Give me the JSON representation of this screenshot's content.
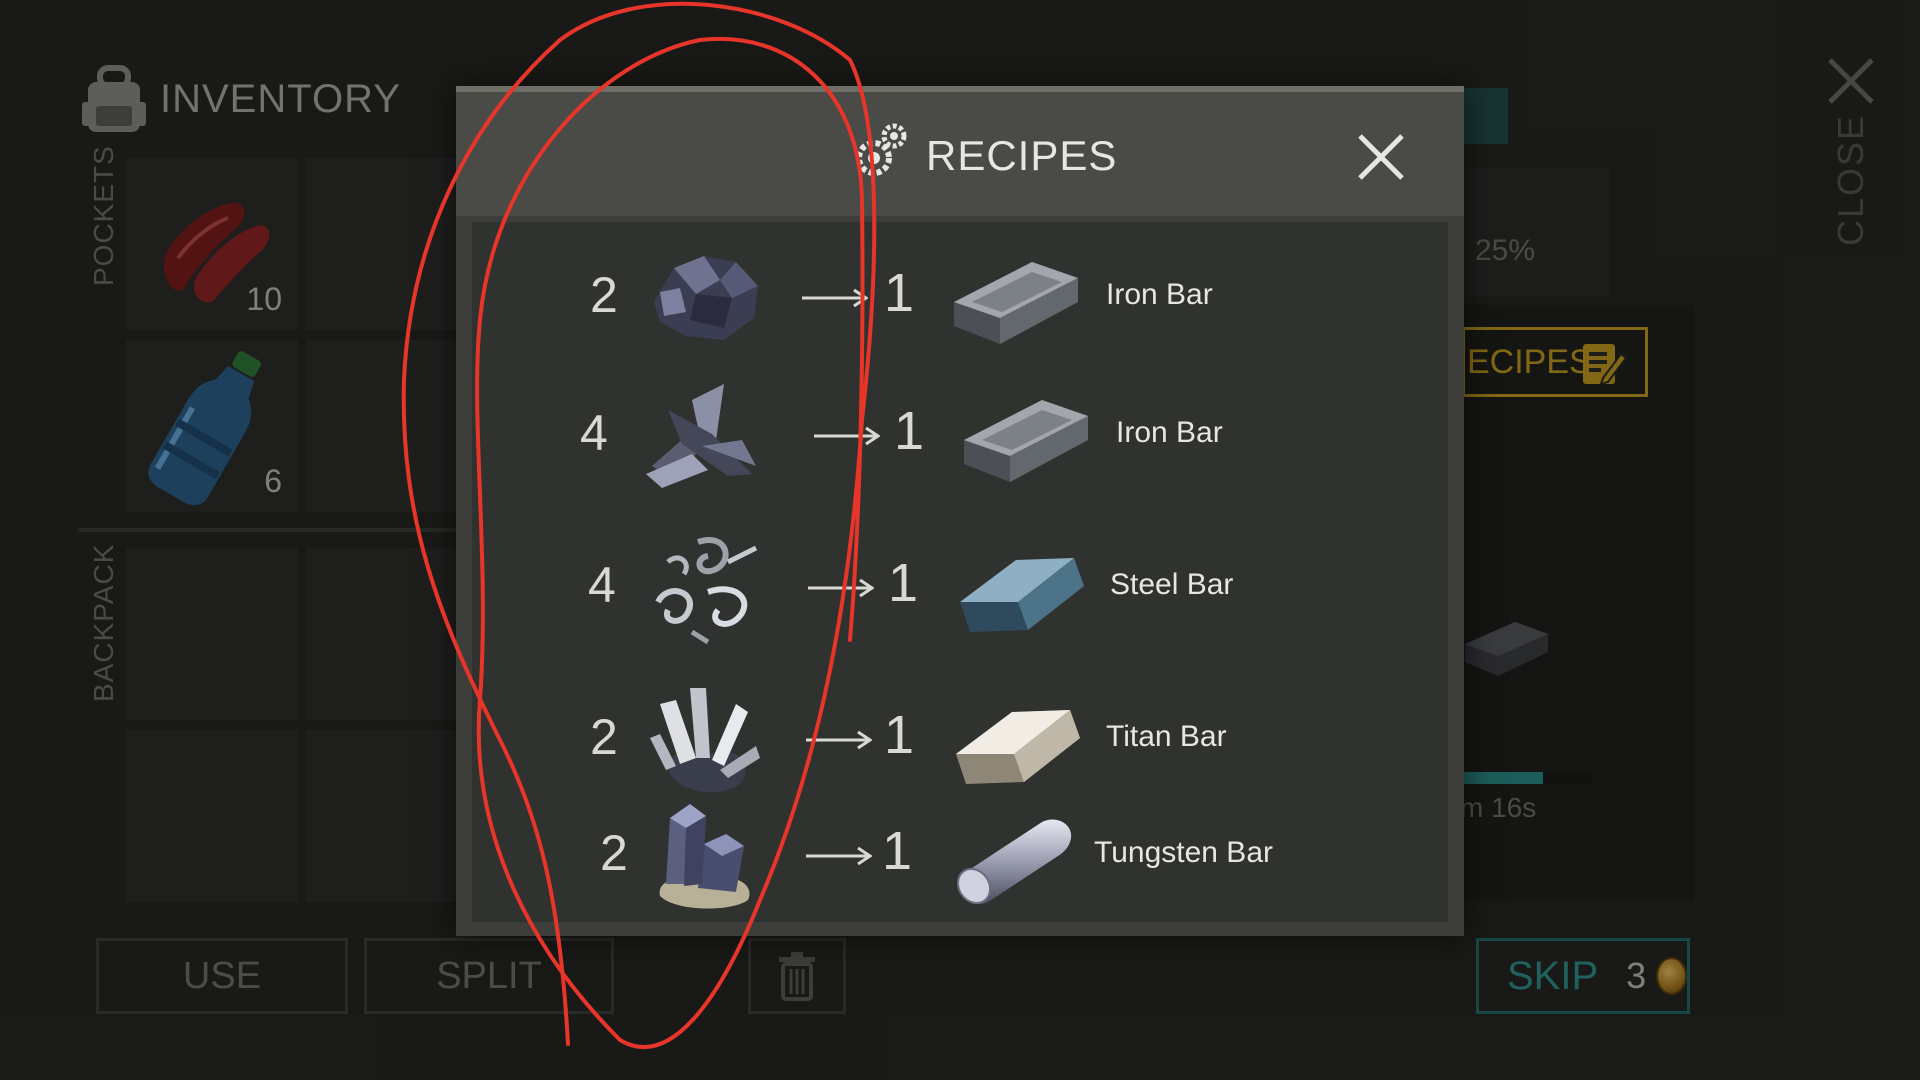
{
  "inventory": {
    "title": "INVENTORY",
    "pockets_label": "POCKETS",
    "backpack_label": "BACKPACK",
    "slots": [
      {
        "item": "raw-meat",
        "count": "10"
      },
      {
        "item": "water-bottle",
        "count": "6"
      }
    ],
    "buttons": {
      "use": "USE",
      "split": "SPLIT"
    }
  },
  "side": {
    "percent": "25%",
    "recipes_tab": "ECIPES",
    "timer": "m 16s",
    "progress": 0.62,
    "skip_label": "SKIP",
    "skip_cost": "3",
    "close_label": "CLOSE"
  },
  "modal": {
    "title": "RECIPES",
    "recipes": [
      {
        "in_qty": "2",
        "ore": "iron-ore",
        "out_qty": "1",
        "out_name": "Iron Bar",
        "bar": "iron"
      },
      {
        "in_qty": "4",
        "ore": "scrap-metal",
        "out_qty": "1",
        "out_name": "Iron Bar",
        "bar": "iron"
      },
      {
        "in_qty": "4",
        "ore": "metal-shavings",
        "out_qty": "1",
        "out_name": "Steel Bar",
        "bar": "steel"
      },
      {
        "in_qty": "2",
        "ore": "titan-crystals",
        "out_qty": "1",
        "out_name": "Titan Bar",
        "bar": "titan"
      },
      {
        "in_qty": "2",
        "ore": "tungsten-crystals",
        "out_qty": "1",
        "out_name": "Tungsten Bar",
        "bar": "tungsten"
      }
    ]
  },
  "colors": {
    "accent_gold": "#c09a1e",
    "accent_teal": "#2e8f88",
    "annotation_red": "#e8352a"
  }
}
